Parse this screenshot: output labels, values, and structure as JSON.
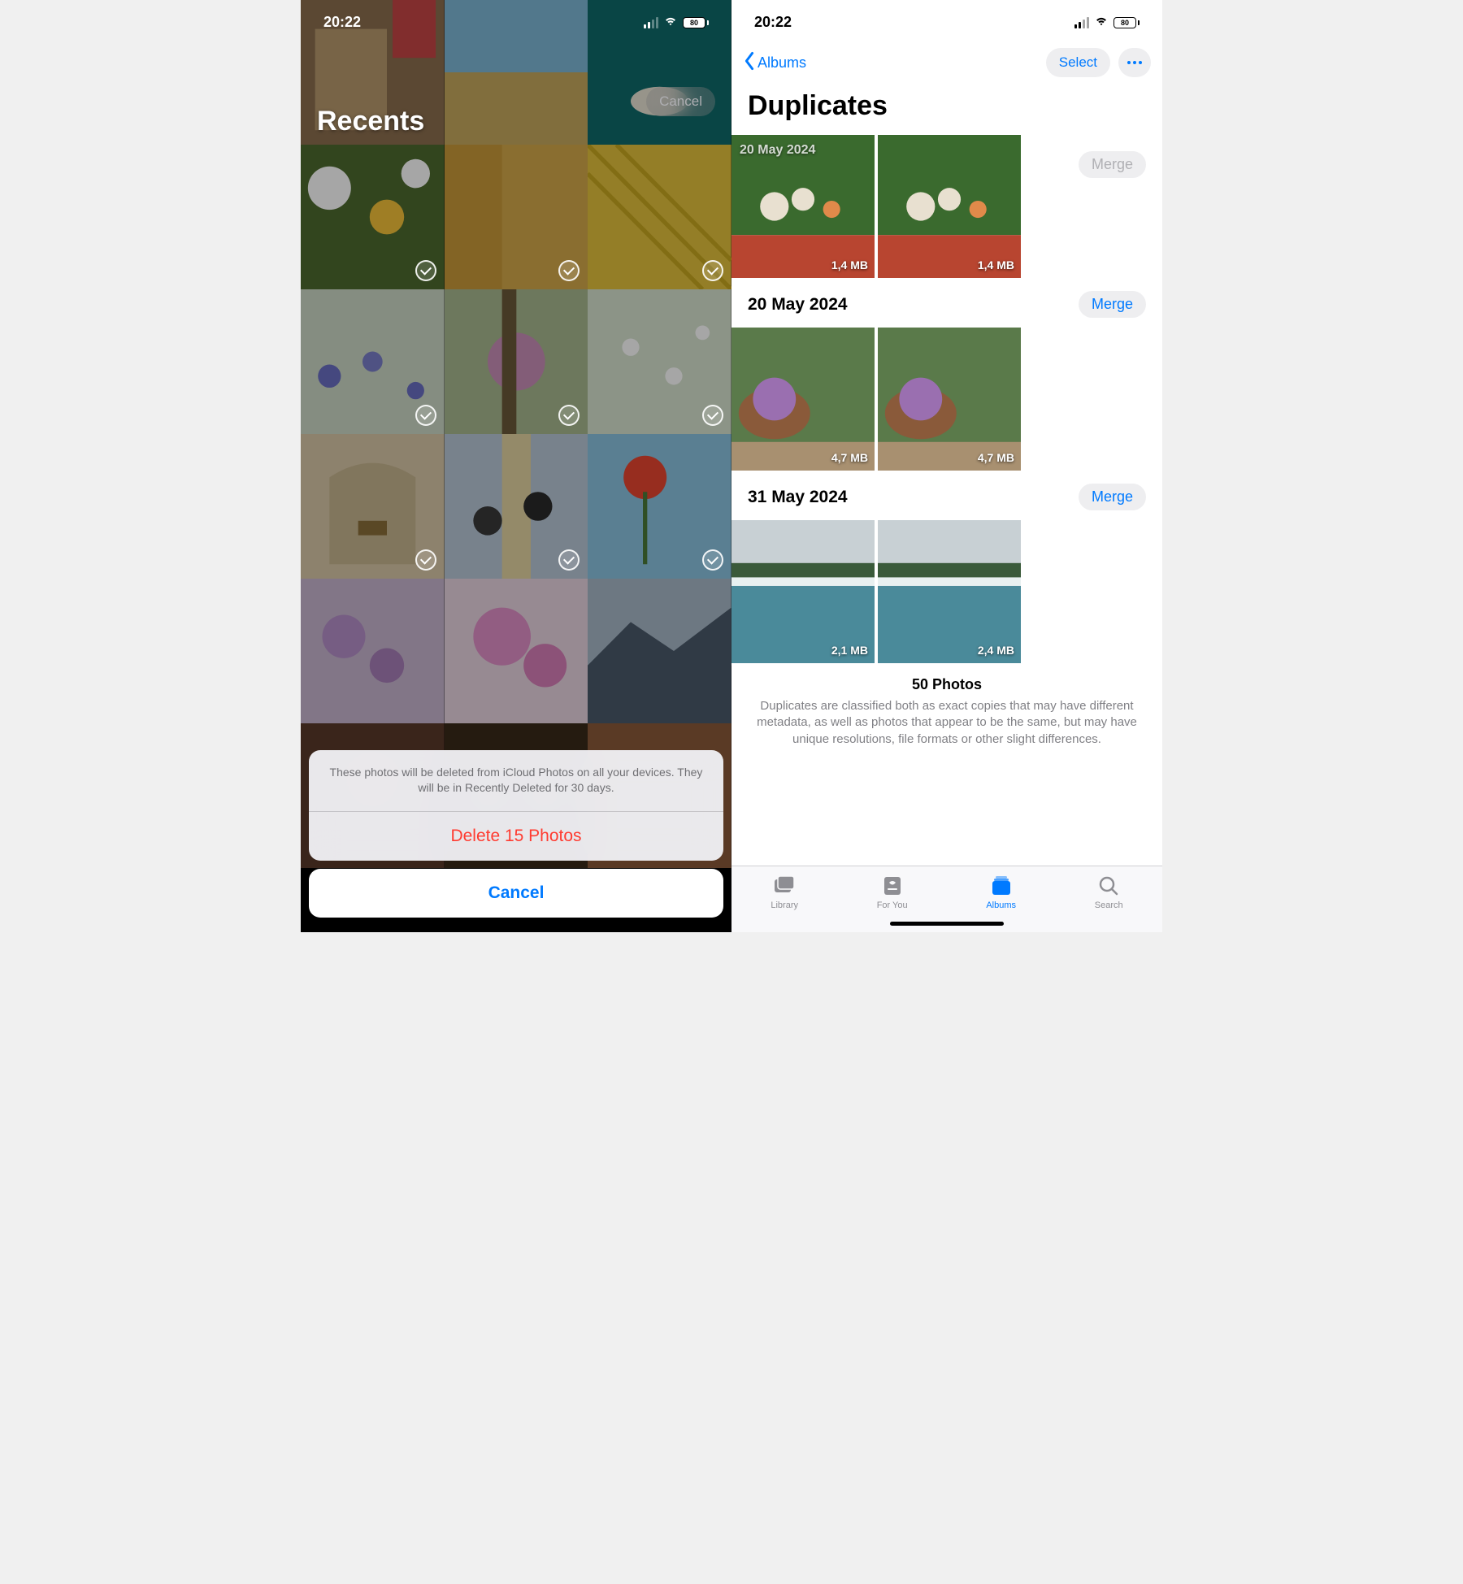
{
  "left": {
    "status_time": "20:22",
    "battery": "80",
    "title": "Recents",
    "top_cancel": "Cancel",
    "sheet_msg": "These photos will be deleted from iCloud Photos on all your devices. They will be in Recently Deleted for 30 days.",
    "delete_btn": "Delete 15 Photos",
    "cancel_btn": "Cancel"
  },
  "right": {
    "status_time": "20:22",
    "battery": "80",
    "back_label": "Albums",
    "select_label": "Select",
    "title": "Duplicates",
    "groups": [
      {
        "date": "20 May 2024",
        "merge": "Merge",
        "merge_disabled": true,
        "sizes": [
          "1,4 MB",
          "1,4 MB"
        ],
        "show_date_overlay": true
      },
      {
        "date": "20 May 2024",
        "merge": "Merge",
        "merge_disabled": false,
        "sizes": [
          "4,7 MB",
          "4,7 MB"
        ]
      },
      {
        "date": "31 May 2024",
        "merge": "Merge",
        "merge_disabled": false,
        "sizes": [
          "2,1 MB",
          "2,4 MB"
        ]
      }
    ],
    "summary_title": "50 Photos",
    "summary_desc": "Duplicates are classified both as exact copies that may have different metadata, as well as photos that appear to be the same, but may have unique resolutions, file formats or other slight differences.",
    "tabs": {
      "library": "Library",
      "foryou": "For You",
      "albums": "Albums",
      "search": "Search"
    }
  }
}
